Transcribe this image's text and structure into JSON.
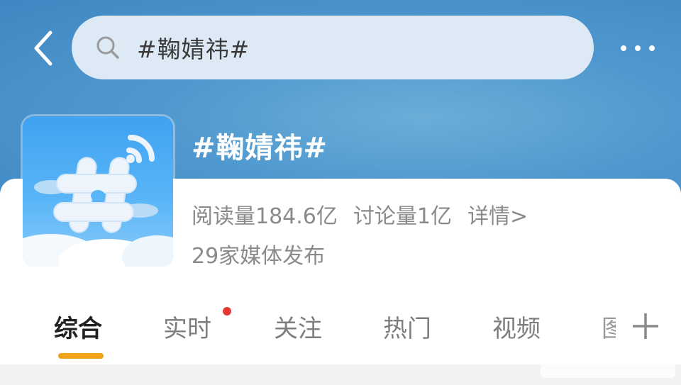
{
  "search": {
    "query": "#鞠婧祎#"
  },
  "topic": {
    "title": "#鞠婧祎#",
    "reads": "阅读量184.6亿",
    "discussions": "讨论量1亿",
    "details_link": "详情>",
    "media_count": "29家媒体发布"
  },
  "tabs": [
    {
      "label": "综合",
      "active": true
    },
    {
      "label": "实时",
      "has_dot": true
    },
    {
      "label": "关注"
    },
    {
      "label": "热门"
    },
    {
      "label": "视频"
    },
    {
      "label": "图"
    }
  ],
  "icons": {
    "back": "chevron-left-icon",
    "search": "search-icon",
    "more": "more-dots-icon",
    "add_tab": "plus-icon"
  },
  "colors": {
    "header_blue": "#4f98cf",
    "active_underline": "#f0a31a",
    "dot_red": "#e53935"
  }
}
